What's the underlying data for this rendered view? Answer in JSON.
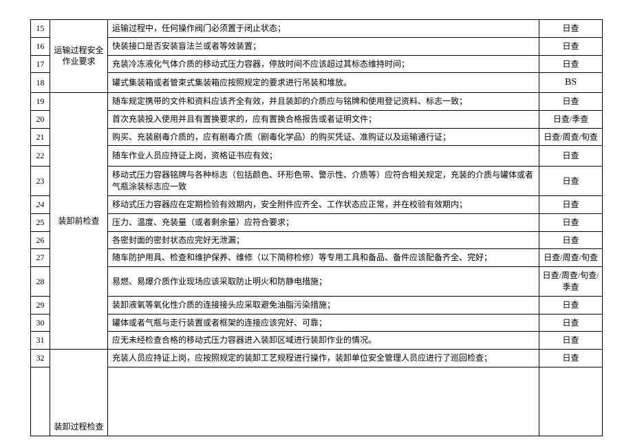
{
  "categories": {
    "transport": "运输过程安全作业要求",
    "preload": "装卸前检查",
    "loading": "装卸过程检查"
  },
  "rows": [
    {
      "n": "15",
      "cat": "transport",
      "desc": "运输过程中，任何操作阀门必须置于闭止状态；",
      "freq": "日查"
    },
    {
      "n": "16",
      "cat": "transport",
      "desc": "快装接口是否安装盲法兰或者等效装置；",
      "freq": "日查"
    },
    {
      "n": "17",
      "cat": "transport",
      "desc": "充装冷冻液化气体介质的移动式压力容器，停放时间不应该超过其标态维持时间；",
      "freq": "日查"
    },
    {
      "n": "18",
      "cat": "transport",
      "desc": "罐式集装箱或者管束式集装箱应按照规定的要求进行吊装和堆放。",
      "freq": "BS"
    },
    {
      "n": "19",
      "cat": "preload",
      "desc": "随车规定携带的文件和资料应该齐全有效，并且装卸的介质应与铭牌和使用登记资料、标志一致；",
      "freq": "日查"
    },
    {
      "n": "20",
      "cat": "preload",
      "desc": "首次充装投入使用并且有置换要求的，应有置换合格报告或者证明文件；",
      "freq": "日查/季查"
    },
    {
      "n": "21",
      "cat": "preload",
      "desc": "购买、充装剧毒介质的，应有剧毒介质（剧毒化学品）的购买凭证、准购证以及运输通行证；",
      "freq": "日查/周查/旬查"
    },
    {
      "n": "22",
      "cat": "preload",
      "desc": "随车作业人员应持证上岗，资格证书应有效；",
      "freq": "日查"
    },
    {
      "n": "23",
      "cat": "preload",
      "desc": "移动式压力容器铭牌与各种标志（包括颜色、环形色带、警示性、介质等）应符合相关规定，充装的介质与罐体或者气瓶涂装标志应一致",
      "freq": "日查"
    },
    {
      "n": "24",
      "cat": "preload",
      "desc": "移动式压力容器应在定期检验有效期内，安全附件应齐全、工作状态应正常，并在校验有效期内；",
      "freq": "日查"
    },
    {
      "n": "25",
      "cat": "preload",
      "desc": "压力、温度、充装量（或者剩余量）应符合要求；",
      "freq": "日查"
    },
    {
      "n": "26",
      "cat": "preload",
      "desc": "各密封面的密封状态应完好无泄漏；",
      "freq": "日查"
    },
    {
      "n": "27",
      "cat": "preload",
      "desc": "随车防护用具、检查和维护保养、维修（以下简称检修）等专用工具和备品、备件应该配备齐全、完好；",
      "freq": "日查/周查/旬查"
    },
    {
      "n": "28",
      "cat": "preload",
      "desc": "易燃、易爆介质作业现场应该采取防止明火和防静电措施；",
      "freq": "日查/周查/旬查/季查"
    },
    {
      "n": "29",
      "cat": "preload",
      "desc": "装卸液氧等氧化性介质的连接接头应采取避免油脂污染措施；",
      "freq": "日查"
    },
    {
      "n": "30",
      "cat": "preload",
      "desc": "罐体或者气瓶与走行装置或者框架的连接应该完好、可靠；",
      "freq": "日查"
    },
    {
      "n": "31",
      "cat": "preload",
      "desc": "应无未经检查合格的移动式压力容器进入装卸区域进行装卸作业的情况。",
      "freq": "日查"
    },
    {
      "n": "32",
      "cat": "loading",
      "desc": "充装人员应持证上岗，应按照规定的装卸工艺规程进行操作，装卸单位安全管理人员应进行了巡回检查；",
      "freq": "日查"
    }
  ]
}
